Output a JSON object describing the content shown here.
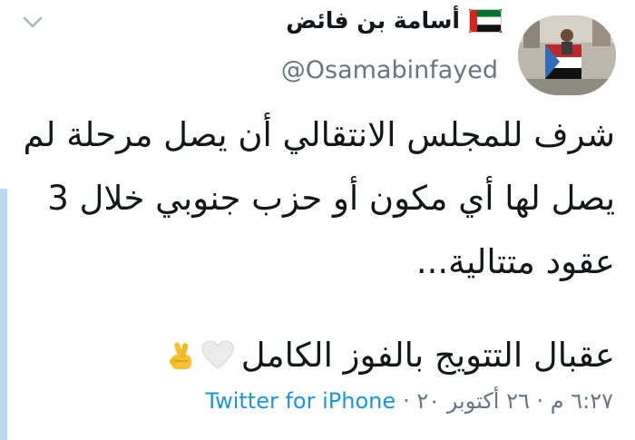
{
  "author": {
    "display_name": "أسامة بن فائض",
    "handle": "@Osamabinfayed",
    "flag_icon": "uae-flag-icon"
  },
  "tweet": {
    "lines": [
      "شرف للمجلس الانتقالي أن يصل مرحلة لم",
      "يصل لها أي مكون أو حزب جنوبي خلال 3",
      "عقود متتالية...",
      "عقبال التتويج بالفوز الكامل"
    ],
    "emojis": [
      "white-heart-icon",
      "crossed-fingers-icon"
    ]
  },
  "meta": {
    "timestamp": "٦:٢٧ م · ٢٦ أكتوبر ٢٠ ·",
    "source": "Twitter for iPhone"
  },
  "colors": {
    "text": "#14171a",
    "secondary": "#657786",
    "link": "#1b95e0"
  }
}
